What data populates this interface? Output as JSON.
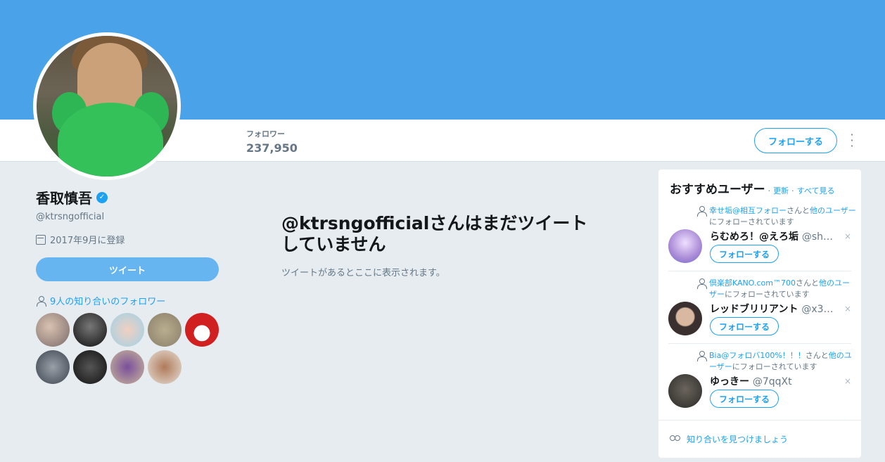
{
  "profile": {
    "name": "香取慎吾",
    "handle": "@ktrsngofficial",
    "joined": "2017年9月に登録",
    "tweet_button": "ツイート",
    "mutual_followers": "9人の知り合いのフォロワー"
  },
  "stats": {
    "label": "フォロワー",
    "value": "237,950"
  },
  "header": {
    "follow_button": "フォローする"
  },
  "timeline": {
    "empty_title": "@ktrsngofficialさんはまだツイートしていません",
    "empty_sub": "ツイートがあるとここに表示されます。"
  },
  "wtf": {
    "title": "おすすめユーザー",
    "dot": "·",
    "refresh": "更新",
    "view_all": "すべて見る",
    "items": [
      {
        "ctx_link1": "幸せ垢@相互フォロー",
        "ctx_mid": "さんと",
        "ctx_link2": "他のユーザー",
        "ctx_end": "にフォローされています",
        "name": "らむめろ！@えろ垢",
        "handle": "@sh…",
        "follow": "フォローする",
        "close": "×"
      },
      {
        "ctx_link1": "倶楽部KANO.com™700",
        "ctx_mid": "さんと",
        "ctx_link2": "他のユーザー",
        "ctx_end": "にフォローされています",
        "name": "レッドブリリアント",
        "handle": "@x3…",
        "follow": "フォローする",
        "close": "×"
      },
      {
        "ctx_link1": "Bia@フォロバ100%！！！",
        "ctx_mid": "さんと",
        "ctx_link2": "他のユーザー",
        "ctx_end": "にフォローされています",
        "name": "ゆっきー",
        "handle": "@7qqXt",
        "follow": "フォローする",
        "close": "×"
      }
    ],
    "find_friends": "知り合いを見つけましょう"
  },
  "colors": {
    "accent": "#1da1f2",
    "banner": "#4aa3e8"
  }
}
